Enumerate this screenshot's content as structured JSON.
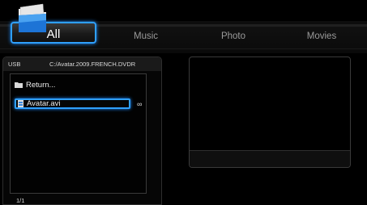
{
  "tabs": [
    {
      "label": "All",
      "active": true
    },
    {
      "label": "Music",
      "active": false
    },
    {
      "label": "Photo",
      "active": false
    },
    {
      "label": "Movies",
      "active": false
    }
  ],
  "browser": {
    "source": "USB",
    "path": "C:/Avatar.2009.FRENCH.DVDR",
    "items": [
      {
        "label": "Return...",
        "icon": "folder-icon"
      },
      {
        "label": "Avatar.avi",
        "icon": "video-file-icon",
        "selected": true
      }
    ],
    "link_icon": "link-icon",
    "page_indicator": "1/1"
  },
  "colors": {
    "accent": "#2fa0ff",
    "background": "#000000"
  }
}
